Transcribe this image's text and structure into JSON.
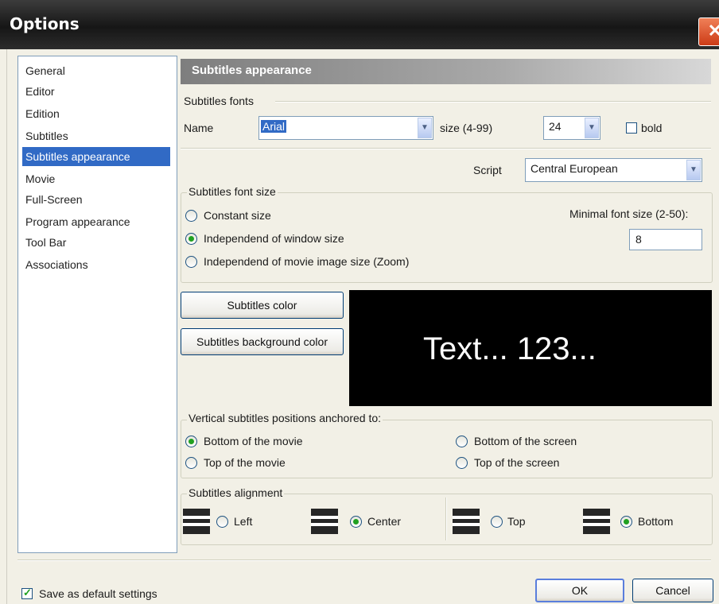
{
  "window": {
    "title": "Options",
    "close_glyph": "✕"
  },
  "nav": {
    "items": [
      "General",
      "Editor",
      "Edition",
      "Subtitles",
      "Subtitles appearance",
      "Movie",
      "Full-Screen",
      "Program appearance",
      "Tool Bar",
      "Associations"
    ],
    "selected": "Subtitles appearance"
  },
  "section": {
    "header": "Subtitles appearance"
  },
  "fonts": {
    "group_label": "Subtitles fonts",
    "name_label": "Name",
    "name_value": "Arial",
    "size_label": "size (4-99)",
    "size_value": "24",
    "bold_label": "bold",
    "bold_checked": false,
    "script_label": "Script",
    "script_value": "Central European"
  },
  "font_size": {
    "group_label": "Subtitles font size",
    "options": [
      "Constant size",
      "Independend of window size",
      "Independend of movie image size (Zoom)"
    ],
    "selected": "Independend of window size",
    "minimal_label": "Minimal font size (2-50):",
    "minimal_value": "8"
  },
  "colors": {
    "color_button": "Subtitles color",
    "background_button": "Subtitles background color",
    "preview_text": "Text... 123...",
    "preview_bg": "#000000",
    "preview_fg": "#ffffff"
  },
  "positions": {
    "group_label": "Vertical subtitles positions anchored to:",
    "options": [
      "Bottom of the movie",
      "Top of the movie",
      "Bottom of the screen",
      "Top of the screen"
    ],
    "selected": "Bottom of the movie"
  },
  "alignment": {
    "group_label": "Subtitles alignment",
    "horizontal": [
      {
        "label": "Left",
        "icon": "align-left-icon",
        "selected": false
      },
      {
        "label": "Center",
        "icon": "align-center-icon",
        "selected": true
      }
    ],
    "vertical": [
      {
        "label": "Top",
        "icon": "align-top-icon",
        "selected": false
      },
      {
        "label": "Bottom",
        "icon": "align-bottom-icon",
        "selected": true
      }
    ]
  },
  "footer": {
    "default_label": "Save as default settings",
    "default_checked": true,
    "ok_label": "OK",
    "cancel_label": "Cancel"
  },
  "colors_theme": {
    "accent": "#316ac5",
    "titlebar": "#1e1e1e",
    "close": "#e0562f",
    "radio_dot": "#21a121"
  }
}
